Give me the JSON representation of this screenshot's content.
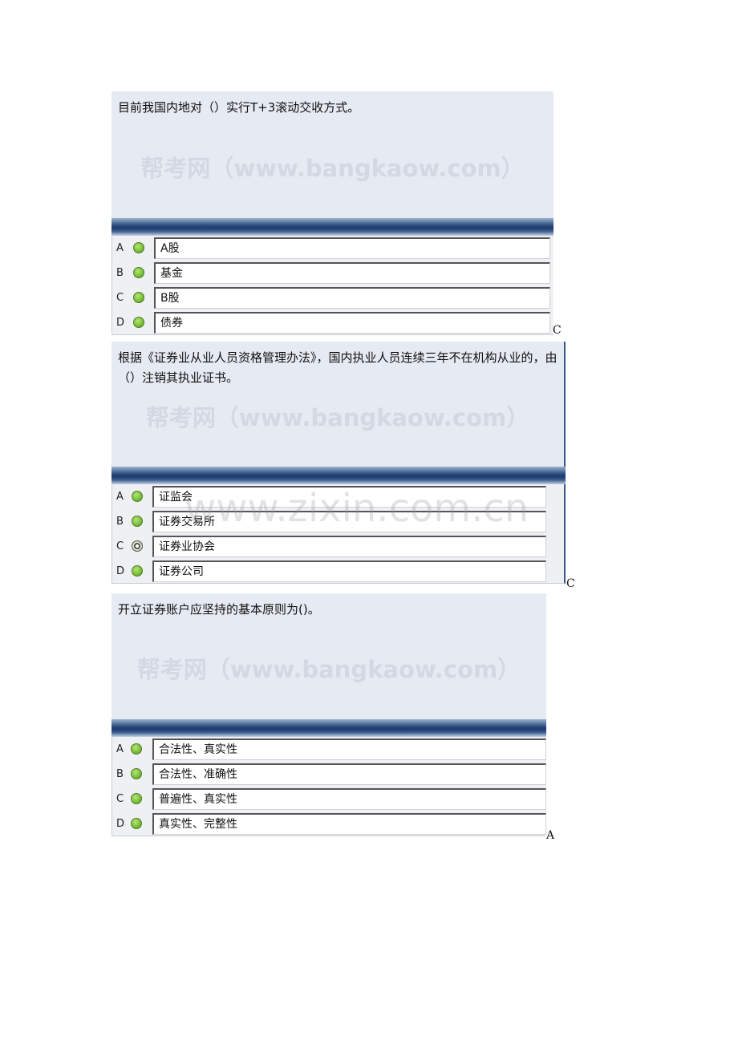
{
  "watermark_panel": "帮考网（www.bangkaow.com）",
  "watermark_page": "www.zixin.com.cn",
  "questions": [
    {
      "text": "目前我国内地对（）实行T+3滚动交收方式。",
      "options": [
        {
          "letter": "A",
          "text": "A股",
          "selected": false
        },
        {
          "letter": "B",
          "text": "基金",
          "selected": false
        },
        {
          "letter": "C",
          "text": "B股",
          "selected": false
        },
        {
          "letter": "D",
          "text": "债券",
          "selected": false
        }
      ],
      "answer": "C"
    },
    {
      "text": "根据《证券业从业人员资格管理办法》，国内执业人员连续三年不在机构从业的，由（）注销其执业证书。",
      "options": [
        {
          "letter": "A",
          "text": "证监会",
          "selected": false
        },
        {
          "letter": "B",
          "text": "证券交易所",
          "selected": false
        },
        {
          "letter": "C",
          "text": "证券业协会",
          "selected": true
        },
        {
          "letter": "D",
          "text": "证券公司",
          "selected": false
        }
      ],
      "answer": "C"
    },
    {
      "text": "开立证券账户应坚持的基本原则为()。",
      "options": [
        {
          "letter": "A",
          "text": "合法性、真实性",
          "selected": false
        },
        {
          "letter": "B",
          "text": "合法性、准确性",
          "selected": false
        },
        {
          "letter": "C",
          "text": "普遍性、真实性",
          "selected": false
        },
        {
          "letter": "D",
          "text": "真实性、完整性",
          "selected": false
        }
      ],
      "answer": "A"
    }
  ]
}
